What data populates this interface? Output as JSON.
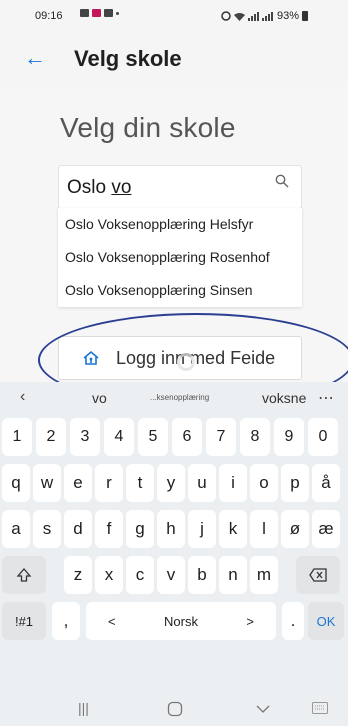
{
  "status": {
    "time": "09:16",
    "battery": "93%"
  },
  "appbar": {
    "title": "Velg skole"
  },
  "page": {
    "heading": "Velg din skole"
  },
  "search": {
    "query_prefix": "Oslo ",
    "query_underlined": "vo"
  },
  "suggestions": [
    "Oslo Voksenopplæring Helsfyr",
    "Oslo Voksenopplæring Rosenhof",
    "Oslo Voksenopplæring Sinsen"
  ],
  "feide": {
    "label": "Logg inn med Feide"
  },
  "keyboard": {
    "suggestion_words": [
      "vo",
      "...ksenopplæring",
      "voksne"
    ],
    "row_numbers": [
      "1",
      "2",
      "3",
      "4",
      "5",
      "6",
      "7",
      "8",
      "9",
      "0"
    ],
    "row1": [
      "q",
      "w",
      "e",
      "r",
      "t",
      "y",
      "u",
      "i",
      "o",
      "p",
      "å"
    ],
    "row2": [
      "a",
      "s",
      "d",
      "f",
      "g",
      "h",
      "j",
      "k",
      "l",
      "ø",
      "æ"
    ],
    "row3": [
      "z",
      "x",
      "c",
      "v",
      "b",
      "n",
      "m"
    ],
    "symbols": "!#1",
    "comma": ",",
    "lang_prev": "<",
    "language": "Norsk",
    "lang_next": ">",
    "period": ".",
    "ok": "OK"
  },
  "colors": {
    "accent": "#1976d2",
    "annotation": "#2a3f92"
  }
}
